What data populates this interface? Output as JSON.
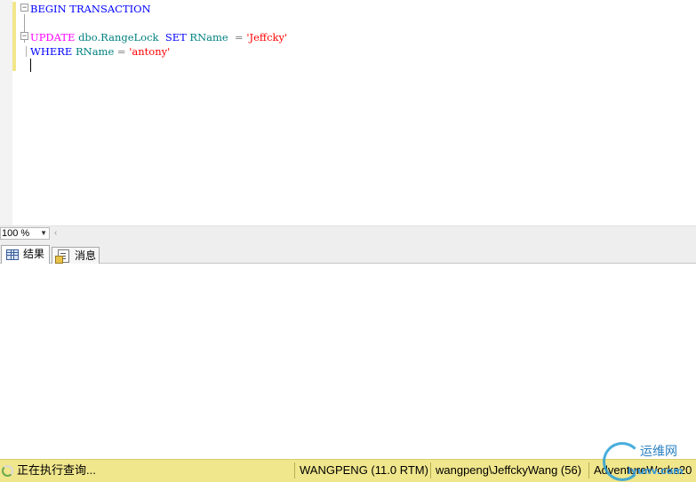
{
  "editor": {
    "lines": [
      {
        "kw": "BEGIN TRANSACTION"
      },
      {},
      {
        "kw": "UPDATE",
        "table": "dbo.RangeLock",
        "set": "SET",
        "col": "RName",
        "eq": "=",
        "val": "'Jeffcky'"
      },
      {
        "kw": "WHERE",
        "col": "RName",
        "eq": "=",
        "val": "'antony'"
      }
    ],
    "colors": {
      "keyword": "#0000ff",
      "dml": "#ff00ff",
      "identifier": "#008080",
      "string": "#ff0000"
    }
  },
  "zoom": {
    "value": "100 %"
  },
  "tabs": [
    {
      "label": "结果",
      "icon": "grid-icon",
      "active": true
    },
    {
      "label": "消息",
      "icon": "message-icon",
      "active": false
    }
  ],
  "status": {
    "text": "正在执行查询...",
    "server": "WANGPENG (11.0 RTM)",
    "user": "wangpeng\\JeffckyWang (56)",
    "database": "AdventureWorks20",
    "background": "#f0e68c"
  },
  "watermark": {
    "text": "运维网",
    "sub": "iyunv.com"
  }
}
